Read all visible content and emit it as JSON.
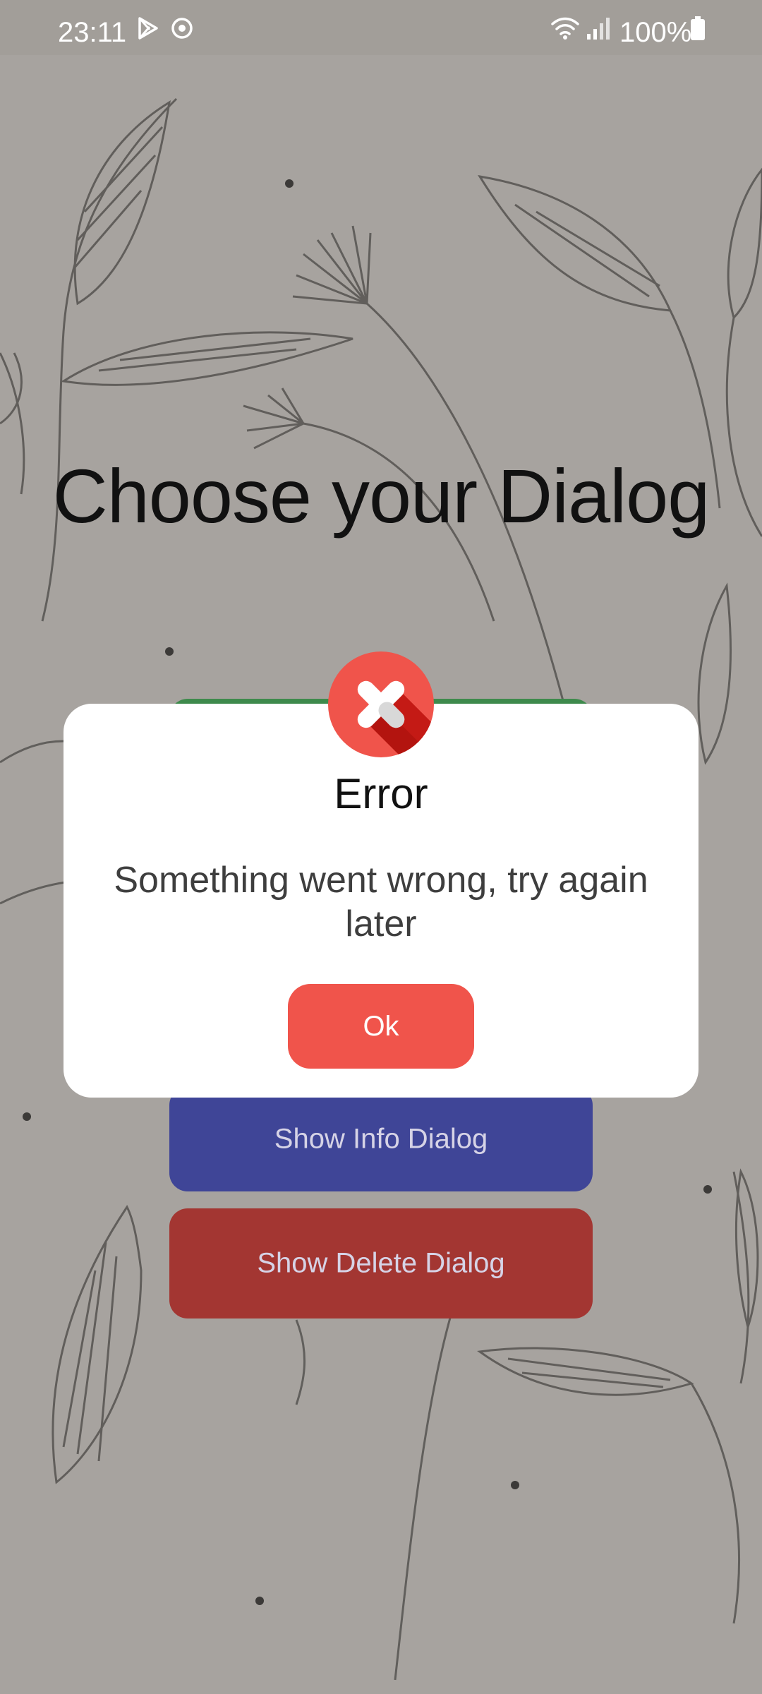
{
  "status_bar": {
    "time": "23:11",
    "battery": "100%",
    "icons": [
      "play-store-icon",
      "sync-icon",
      "wifi-icon",
      "signal-icon",
      "battery-icon"
    ]
  },
  "page": {
    "title": "Choose your Dialog",
    "background_color": "#a7a39f"
  },
  "buttons": {
    "info_label": "Show Info Dialog",
    "delete_label": "Show Delete Dialog",
    "info_color": "#3f4597",
    "delete_color": "#a33632",
    "success_color": "#3e8a4c"
  },
  "dialog": {
    "title": "Error",
    "message": "Something went wrong, try again later",
    "ok_label": "Ok",
    "icon": "error-x-icon",
    "accent_color": "#f0544b"
  }
}
